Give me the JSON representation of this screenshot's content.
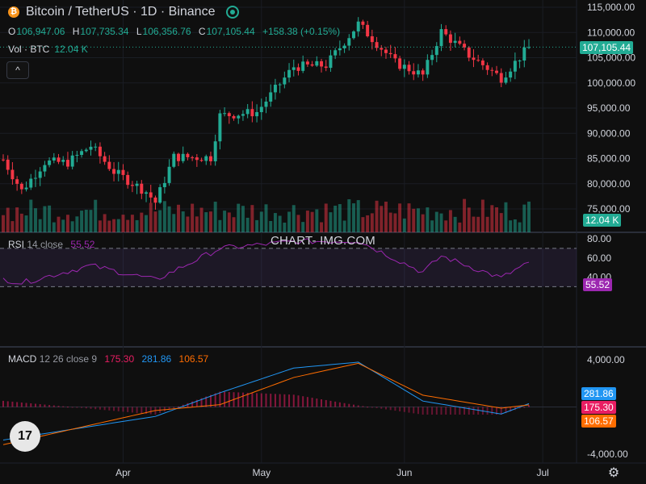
{
  "header": {
    "title": "Bitcoin / TetherUS · 1D · Binance",
    "ohlc": [
      {
        "k": "O",
        "v": "106,947.06"
      },
      {
        "k": "H",
        "v": "107,735.34"
      },
      {
        "k": "L",
        "v": "106,356.76"
      },
      {
        "k": "C",
        "v": "107,105.44"
      },
      {
        "k": "",
        "v": "+158.38 (+0.15%)"
      }
    ],
    "vol_label": "Vol · BTC",
    "vol_value": "12.04 K",
    "collapse_glyph": "^"
  },
  "watermark": "CHART- IMG.COM",
  "logo_text": "17",
  "rsi": {
    "label": "RSI",
    "params": "14 close",
    "value": "55.52"
  },
  "macd": {
    "label": "MACD",
    "params": "12 26 close 9",
    "v1": "175.30",
    "v2": "281.86",
    "v3": "106.57"
  },
  "price_axis": [
    "115,000.00",
    "110,000.00",
    "105,000.00",
    "100,000.00",
    "95,000.00",
    "90,000.00",
    "85,000.00",
    "80,000.00",
    "75,000.00"
  ],
  "rsi_axis": [
    "80.00",
    "60.00",
    "40.00"
  ],
  "macd_axis": [
    "4,000.00",
    "-4,000.00"
  ],
  "time_axis": [
    "Apr",
    "May",
    "Jun",
    "Jul"
  ],
  "badges": {
    "price": "107,105.44",
    "volume": "12.04 K",
    "rsi": "55.52",
    "macd_signal": "281.86",
    "macd_line": "175.30",
    "macd_hist": "106.57"
  },
  "colors": {
    "up": "#22ab94",
    "down": "#f23645",
    "rsi": "#9c27b0",
    "macd_blue": "#2196f3",
    "macd_orange": "#ff6d00",
    "hist_pink": "#e91e63"
  },
  "chart_data": {
    "type": "candlestick",
    "title": "Bitcoin / TetherUS · 1D · Binance",
    "x_range": [
      "2025-03-06",
      "2025-06-28"
    ],
    "ylim": [
      72000,
      116000
    ],
    "last_close": 107105.44,
    "candles_sampled_close": [
      {
        "date": "2025-03-06",
        "close": 84800
      },
      {
        "date": "2025-03-10",
        "close": 78600
      },
      {
        "date": "2025-03-15",
        "close": 84300
      },
      {
        "date": "2025-03-20",
        "close": 84200
      },
      {
        "date": "2025-03-25",
        "close": 87500
      },
      {
        "date": "2025-03-30",
        "close": 82400
      },
      {
        "date": "2025-04-06",
        "close": 78400
      },
      {
        "date": "2025-04-08",
        "close": 76300
      },
      {
        "date": "2025-04-12",
        "close": 85300
      },
      {
        "date": "2025-04-20",
        "close": 85200
      },
      {
        "date": "2025-04-22",
        "close": 93500
      },
      {
        "date": "2025-04-30",
        "close": 94200
      },
      {
        "date": "2025-05-08",
        "close": 103200
      },
      {
        "date": "2025-05-15",
        "close": 103500
      },
      {
        "date": "2025-05-22",
        "close": 111700
      },
      {
        "date": "2025-05-30",
        "close": 104000
      },
      {
        "date": "2025-06-05",
        "close": 101500
      },
      {
        "date": "2025-06-09",
        "close": 110200
      },
      {
        "date": "2025-06-15",
        "close": 105500
      },
      {
        "date": "2025-06-22",
        "close": 101000
      },
      {
        "date": "2025-06-28",
        "close": 107105
      }
    ],
    "rsi_sampled": [
      {
        "date": "2025-03-06",
        "value": 38
      },
      {
        "date": "2025-03-10",
        "value": 34
      },
      {
        "date": "2025-03-25",
        "value": 52
      },
      {
        "date": "2025-04-08",
        "value": 37
      },
      {
        "date": "2025-04-22",
        "value": 70
      },
      {
        "date": "2025-05-08",
        "value": 77
      },
      {
        "date": "2025-05-22",
        "value": 78
      },
      {
        "date": "2025-06-05",
        "value": 45
      },
      {
        "date": "2025-06-09",
        "value": 62
      },
      {
        "date": "2025-06-22",
        "value": 39
      },
      {
        "date": "2025-06-28",
        "value": 55.52
      }
    ],
    "rsi_bands": [
      30,
      70
    ],
    "macd_sampled": [
      {
        "date": "2025-03-06",
        "macd": -2800,
        "signal": -3200
      },
      {
        "date": "2025-04-08",
        "macd": -800,
        "signal": -300
      },
      {
        "date": "2025-04-22",
        "macd": 1200,
        "signal": 200
      },
      {
        "date": "2025-05-08",
        "macd": 3300,
        "signal": 2500
      },
      {
        "date": "2025-05-22",
        "macd": 3800,
        "signal": 3700
      },
      {
        "date": "2025-06-05",
        "macd": 500,
        "signal": 1000
      },
      {
        "date": "2025-06-22",
        "macd": -600,
        "signal": -100
      },
      {
        "date": "2025-06-28",
        "macd": 281.86,
        "signal": 175.3
      }
    ],
    "macd_ylim": [
      -4000,
      4000
    ]
  }
}
